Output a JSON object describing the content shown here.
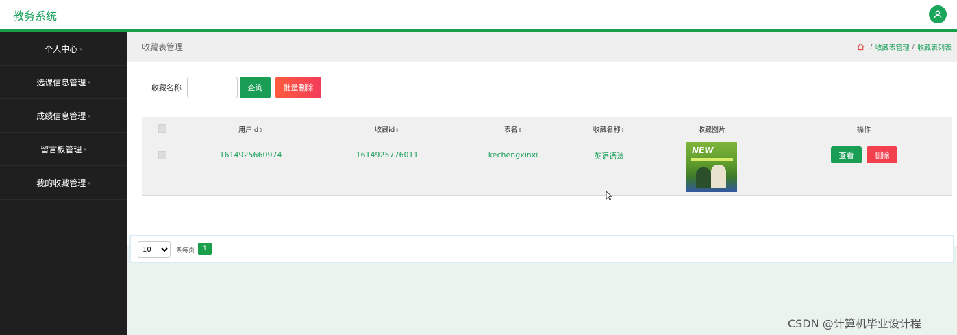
{
  "app": {
    "title": "教务系统"
  },
  "sidebar": {
    "items": [
      {
        "label": "个人中心"
      },
      {
        "label": "选课信息管理"
      },
      {
        "label": "成绩信息管理"
      },
      {
        "label": "留言板管理"
      },
      {
        "label": "我的收藏管理"
      }
    ]
  },
  "page": {
    "title": "收藏表管理",
    "breadcrumb": [
      "收藏表管理",
      "收藏表列表"
    ]
  },
  "search": {
    "label": "收藏名称",
    "value": "",
    "query_label": "查询",
    "bulk_delete_label": "批量删除"
  },
  "table": {
    "columns": [
      "用户id",
      "收藏id",
      "表名",
      "收藏名称",
      "收藏图片",
      "操作"
    ],
    "rows": [
      {
        "user_id": "1614925660974",
        "fav_id": "1614925776011",
        "table_name": "kechengxinxi",
        "fav_name": "英语语法",
        "image_text": "NEW",
        "view_label": "查看",
        "delete_label": "删除"
      }
    ]
  },
  "pagination": {
    "page_size": "10",
    "per_page_label": "条每页",
    "current_page": "1"
  },
  "watermark": "CSDN @计算机毕业设计程",
  "colors": {
    "brand": "#1aa05a",
    "sidebar_bg": "#1f1f1f",
    "danger": "#f2404f"
  }
}
